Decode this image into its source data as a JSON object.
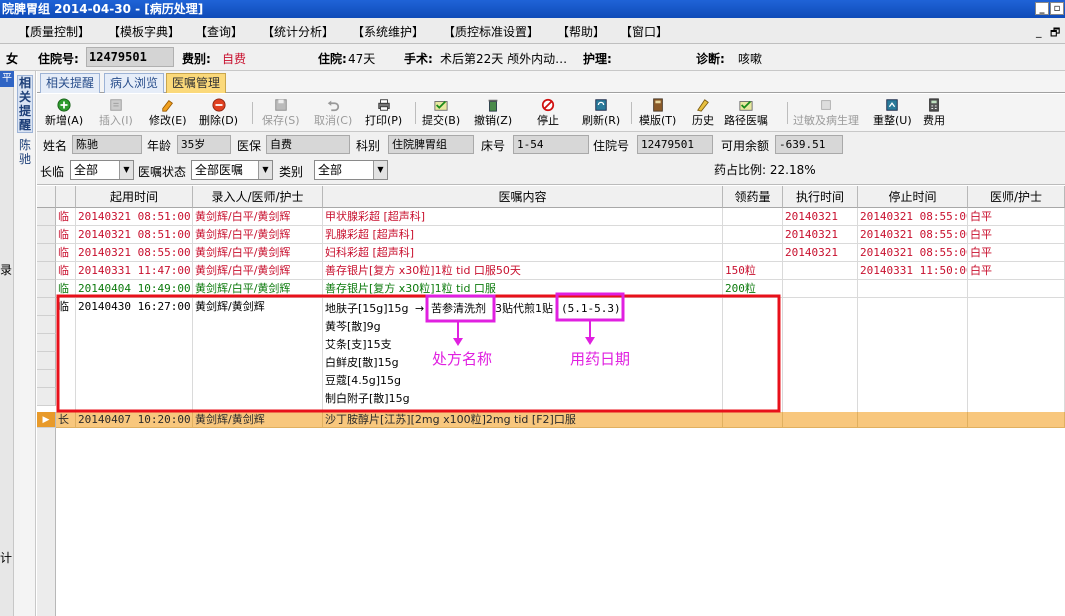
{
  "title_bar": {
    "text": "院脾胃组   2014-04-30 - [病历处理]",
    "minimize": "_",
    "restore": "▫"
  },
  "menu": [
    "【质量控制】",
    "【模板字典】",
    "【查询】",
    "【统计分析】",
    "【系统维护】",
    "【质控标准设置】",
    "【帮助】",
    "【窗口】"
  ],
  "mdi_controls": {
    "minimize": "_",
    "restore": "🗗"
  },
  "patient_header": {
    "sex": "女",
    "inpatient_no_label": "住院号:",
    "inpatient_no": "12479501",
    "fee_type_label": "费别:",
    "fee_type": "自费",
    "stay_label": "住院:",
    "stay": "47天",
    "surgery_label": "手术:",
    "surgery": "术后第22天  颅外内动…",
    "nursing_label": "护理:",
    "diagnosis_label": "诊断:",
    "diagnosis": "咳嗽"
  },
  "left_strip": {
    "top": "平",
    "mid": "录",
    "bottom": "计"
  },
  "vertical_tabs": [
    {
      "label": "相关提醒"
    },
    {
      "label": "陈驰"
    }
  ],
  "tabs": [
    {
      "label": "相关提醒",
      "active": false
    },
    {
      "label": "病人浏览",
      "active": false
    },
    {
      "label": "医嘱管理",
      "active": true
    }
  ],
  "toolbar": [
    {
      "label": "新增(A)",
      "icon": "add-icon",
      "enabled": true
    },
    {
      "label": "插入(I)",
      "icon": "insert-icon",
      "enabled": false
    },
    {
      "label": "修改(E)",
      "icon": "edit-icon",
      "enabled": true
    },
    {
      "label": "删除(D)",
      "icon": "delete-icon",
      "enabled": true
    },
    {
      "label": "保存(S)",
      "icon": "save-icon",
      "enabled": false
    },
    {
      "label": "取消(C)",
      "icon": "undo-icon",
      "enabled": false
    },
    {
      "label": "打印(P)",
      "icon": "print-icon",
      "enabled": true
    },
    {
      "label": "提交(B)",
      "icon": "submit-icon",
      "enabled": true
    },
    {
      "label": "撤销(Z)",
      "icon": "trash-icon",
      "enabled": true
    },
    {
      "label": "停止",
      "icon": "stop-icon",
      "enabled": true
    },
    {
      "label": "刷新(R)",
      "icon": "refresh-icon",
      "enabled": true
    },
    {
      "label": "模版(T)",
      "icon": "template-icon",
      "enabled": true
    },
    {
      "label": "历史",
      "icon": "history-icon",
      "enabled": true
    },
    {
      "label": "路径医嘱",
      "icon": "pathway-icon",
      "enabled": true
    },
    {
      "label": "过敏及病生理",
      "icon": "allergy-icon",
      "enabled": false
    },
    {
      "label": "重整(U)",
      "icon": "reorganize-icon",
      "enabled": true
    },
    {
      "label": "费用",
      "icon": "calculator-icon",
      "enabled": true
    }
  ],
  "patient_row": {
    "name_label": "姓名",
    "name": "陈驰",
    "age_label": "年龄",
    "age": "35岁",
    "insurance_label": "医保",
    "insurance": "自费",
    "dept_label": "科别",
    "dept": "住院脾胃组",
    "bed_label": "床号",
    "bed": "1-54",
    "inpatient_label": "住院号",
    "inpatient_no": "12479501",
    "balance_label": "可用余额",
    "balance": "-639.51"
  },
  "filters": {
    "long_temp_label": "长临",
    "long_temp_value": "全部",
    "status_label": "医嘱状态",
    "status_value": "全部医嘱",
    "category_label": "类别",
    "category_value": "全部",
    "drug_ratio": "药占比例: 22.18%"
  },
  "grid": {
    "headers": [
      "起用时间",
      "录入人/医师/护士",
      "医嘱内容",
      "领药量",
      "执行时间",
      "停止时间",
      "医师/护士"
    ],
    "rows": [
      {
        "type": "临",
        "start": "20140321 08:51:00",
        "entry": "黄剑辉/白平/黄剑辉",
        "content": "甲状腺彩超   [超声科]",
        "amount": "",
        "exec": "20140321",
        "stop": "20140321 08:55:00",
        "doctor": "白平",
        "color": "red"
      },
      {
        "type": "临",
        "start": "20140321 08:51:00",
        "entry": "黄剑辉/白平/黄剑辉",
        "content": "乳腺彩超   [超声科]",
        "amount": "",
        "exec": "20140321",
        "stop": "20140321 08:55:00",
        "doctor": "白平",
        "color": "red"
      },
      {
        "type": "临",
        "start": "20140321 08:55:00",
        "entry": "黄剑辉/白平/黄剑辉",
        "content": "妇科彩超   [超声科]",
        "amount": "",
        "exec": "20140321",
        "stop": "20140321 08:55:00",
        "doctor": "白平",
        "color": "red"
      },
      {
        "type": "临",
        "start": "20140331 11:47:00",
        "entry": "黄剑辉/白平/黄剑辉",
        "content": "善存银片[复方 x30粒]1粒  tid 口服50天",
        "amount": "150粒",
        "exec": "",
        "stop": "20140331 11:50:00",
        "doctor": "白平",
        "color": "red"
      },
      {
        "type": "临",
        "start": "20140404 10:49:00",
        "entry": "黄剑辉/白平/黄剑辉",
        "content": "善存银片[复方 x30粒]1粒  tid 口服",
        "amount": "200粒",
        "exec": "",
        "stop": "",
        "doctor": "",
        "color": "green"
      }
    ],
    "herbal": {
      "type": "临",
      "start": "20140430 16:27:00",
      "entry": "黄剑辉/黄剑辉",
      "items": [
        "地肤子[15g]15g",
        "黄芩[散]9g",
        "艾条[支]15支",
        "白鲜皮[散]15g",
        "豆蔻[4.5g]15g",
        "制白附子[散]15g"
      ],
      "arrow": "→",
      "prescription_name": "苦参清洗剂",
      "dose_text": "3贴代煎1贴",
      "period": "(5.1-5.3)"
    },
    "last_row": {
      "type": "长",
      "start": "20140407 10:20:00",
      "entry": "黄剑辉/黄剑辉",
      "content": "沙丁胺醇片[江苏][2mg x100粒]2mg  tid [F2]口服",
      "marker": "▶"
    }
  },
  "annotations": {
    "prescription_label": "处方名称",
    "period_label": "用药日期",
    "color": "#e020e0",
    "box_color": "#e8101a"
  }
}
